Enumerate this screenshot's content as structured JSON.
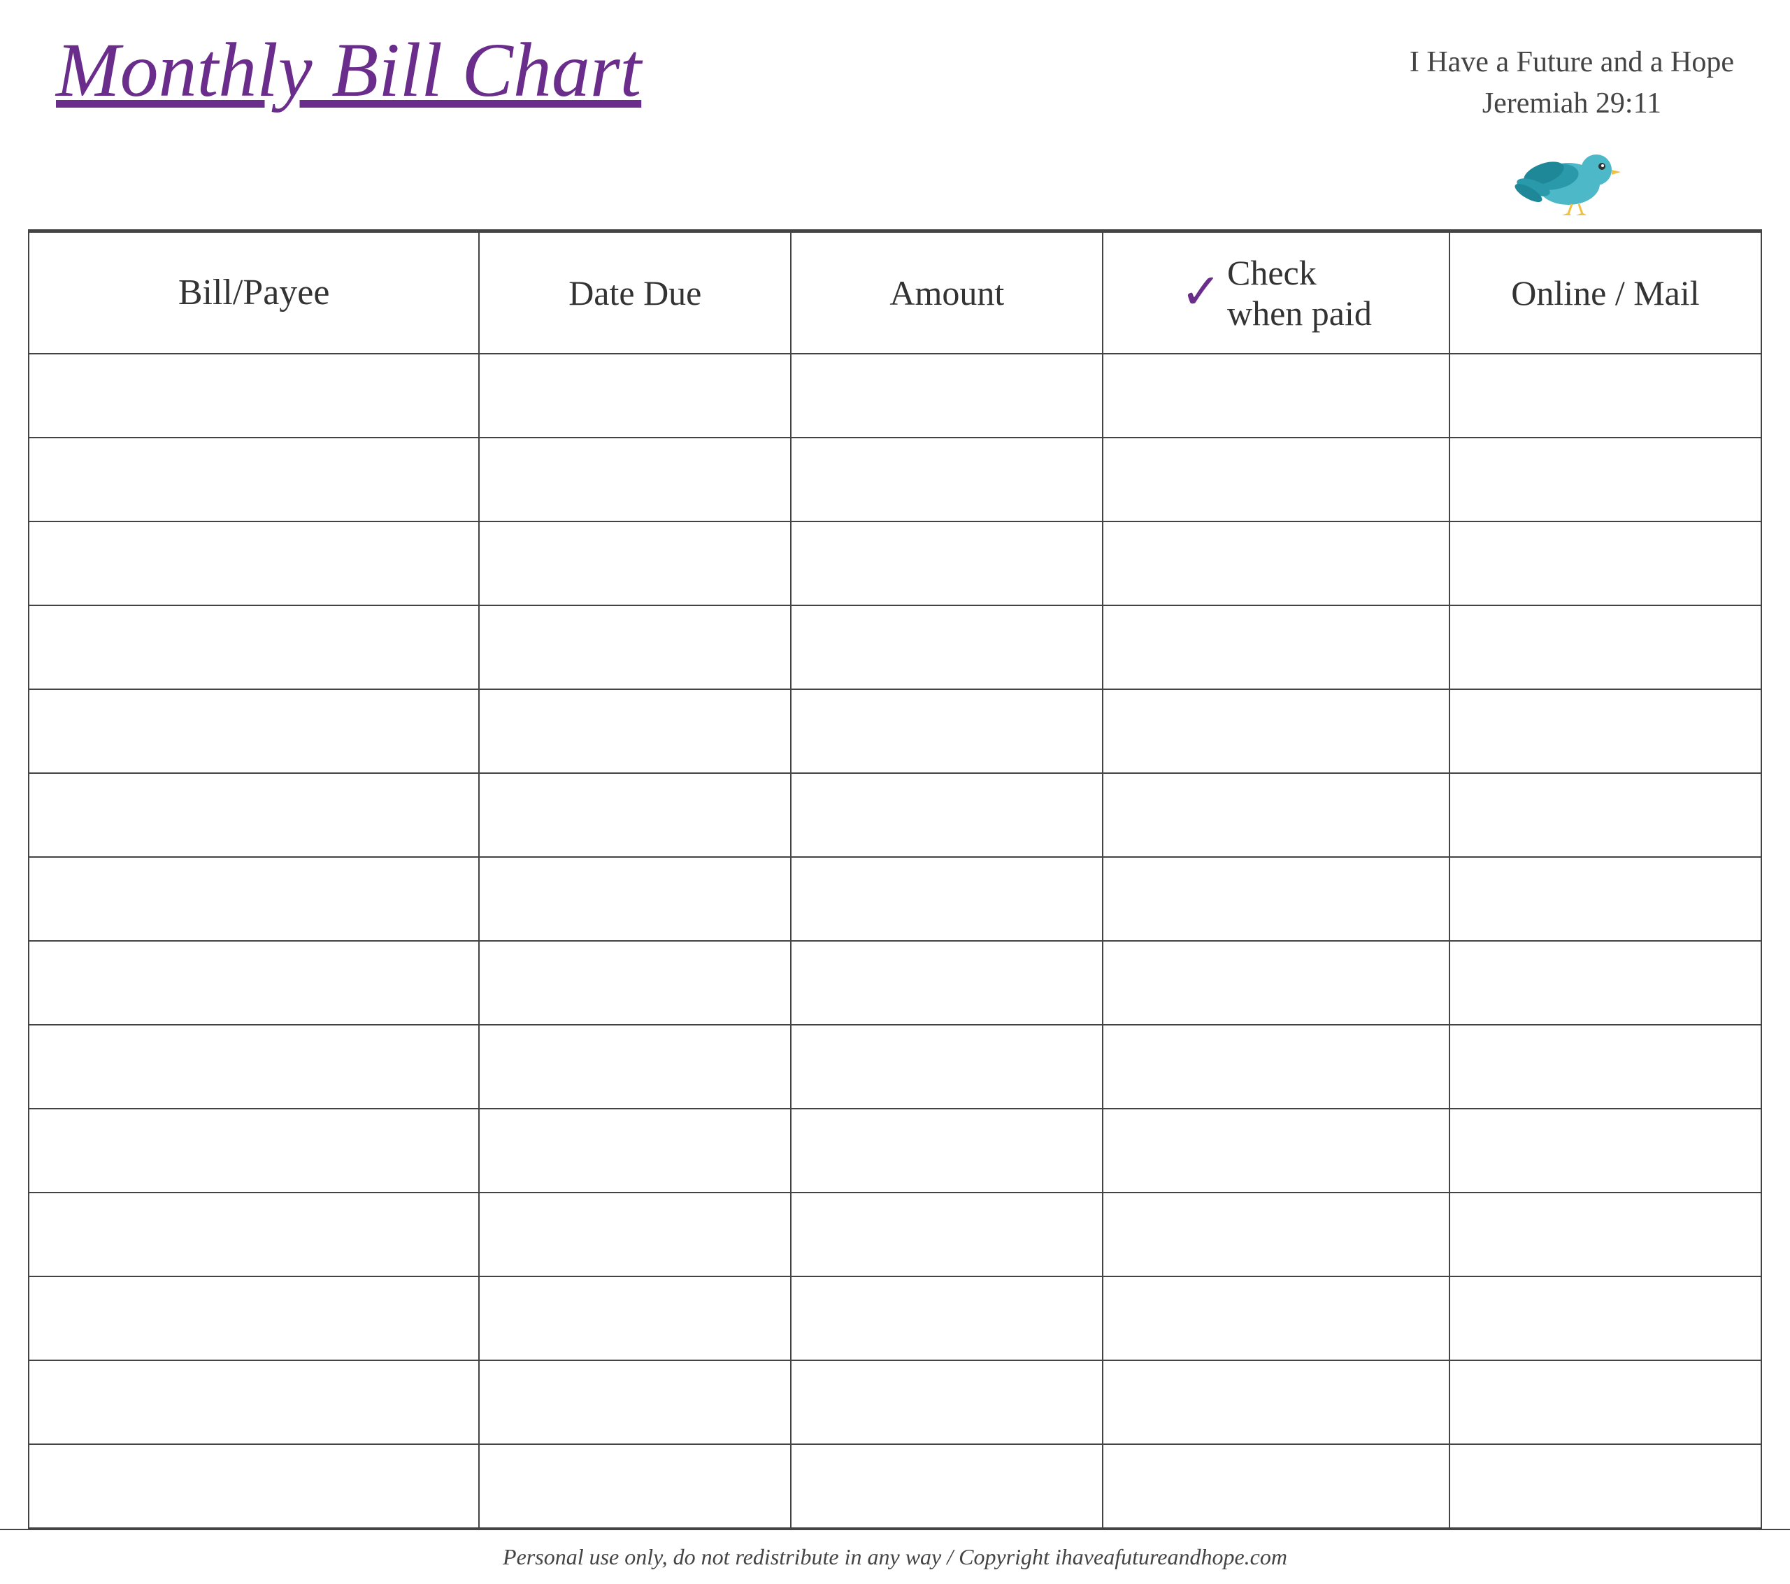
{
  "header": {
    "title": "Monthly Bill Chart",
    "scripture_line1": "I Have a Future and a Hope",
    "scripture_line2": "Jeremiah 29:11"
  },
  "table": {
    "columns": [
      {
        "id": "bill-payee",
        "label": "Bill/Payee"
      },
      {
        "id": "date-due",
        "label": "Date Due"
      },
      {
        "id": "amount",
        "label": "Amount"
      },
      {
        "id": "check-when-paid",
        "label_line1": "Check",
        "label_line2": "when paid",
        "has_checkmark": true
      },
      {
        "id": "online-mail",
        "label": "Online / Mail"
      }
    ],
    "rows": 14
  },
  "footer": {
    "text": "Personal use only, do not redistribute in any way / Copyright ihaveafutureandhope.com"
  },
  "colors": {
    "title": "#6b2d8b",
    "checkmark": "#6b2d8b",
    "border": "#444444",
    "text": "#333333",
    "footer_text": "#444444"
  }
}
